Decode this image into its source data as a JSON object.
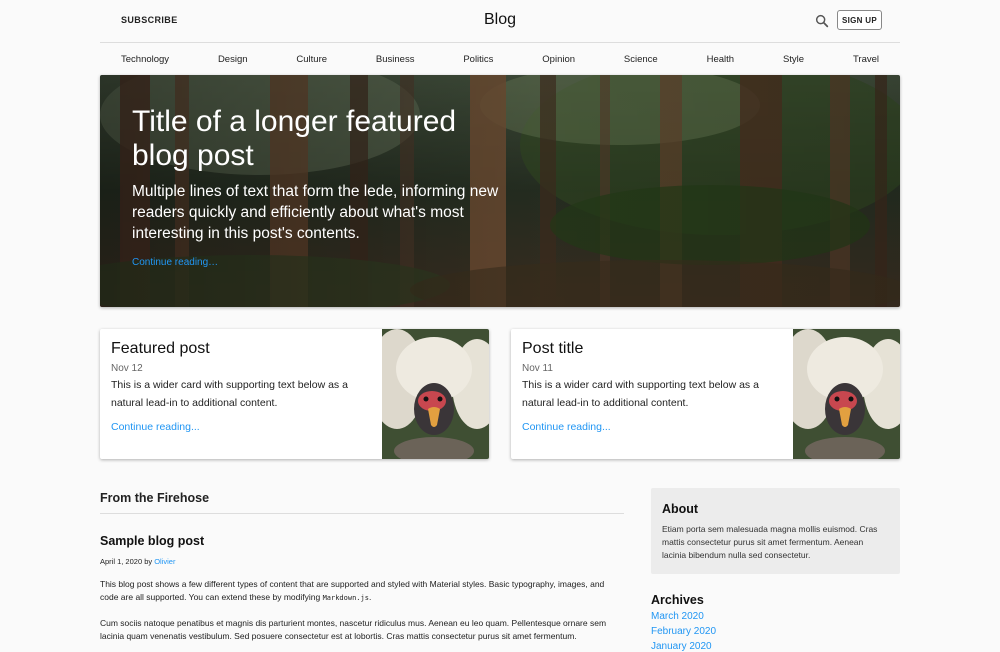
{
  "header": {
    "subscribe_label": "SUBSCRIBE",
    "title": "Blog",
    "signup_label": "SIGN UP",
    "search_icon": "search-icon"
  },
  "nav": [
    "Technology",
    "Design",
    "Culture",
    "Business",
    "Politics",
    "Opinion",
    "Science",
    "Health",
    "Style",
    "Travel"
  ],
  "hero": {
    "title": "Title of a longer featured blog post",
    "lede": "Multiple lines of text that form the lede, informing new readers quickly and efficiently about what's most interesting in this post's contents.",
    "link": "Continue reading…"
  },
  "cards": [
    {
      "title": "Featured post",
      "date": "Nov 12",
      "text": "This is a wider card with supporting text below as a natural lead-in to additional content.",
      "link": "Continue reading..."
    },
    {
      "title": "Post title",
      "date": "Nov 11",
      "text": "This is a wider card with supporting text below as a natural lead-in to additional content.",
      "link": "Continue reading..."
    }
  ],
  "main": {
    "section_heading": "From the Firehose",
    "post": {
      "title": "Sample blog post",
      "date_prefix": "April 1, 2020 by ",
      "author": "Olivier",
      "p1_before": "This blog post shows a few different types of content that are supported and styled with Material styles. Basic typography, images, and code are all supported. You can extend these by modifying ",
      "p1_code": "Markdown.js",
      "p1_after": ".",
      "p2": "Cum sociis natoque penatibus et magnis dis parturient montes, nascetur ridiculus mus. Aenean eu leo quam. Pellentesque ornare sem lacinia quam venenatis vestibulum. Sed posuere consectetur est at lobortis. Cras mattis consectetur purus sit amet fermentum."
    }
  },
  "sidebar": {
    "about_title": "About",
    "about_text": "Etiam porta sem malesuada magna mollis euismod. Cras mattis consectetur purus sit amet fermentum. Aenean lacinia bibendum nulla sed consectetur.",
    "archives_title": "Archives",
    "archives": [
      "March 2020",
      "February 2020",
      "January 2020"
    ]
  },
  "colors": {
    "link": "#2196f3",
    "background": "#fafafa",
    "about_bg": "#ececec"
  }
}
